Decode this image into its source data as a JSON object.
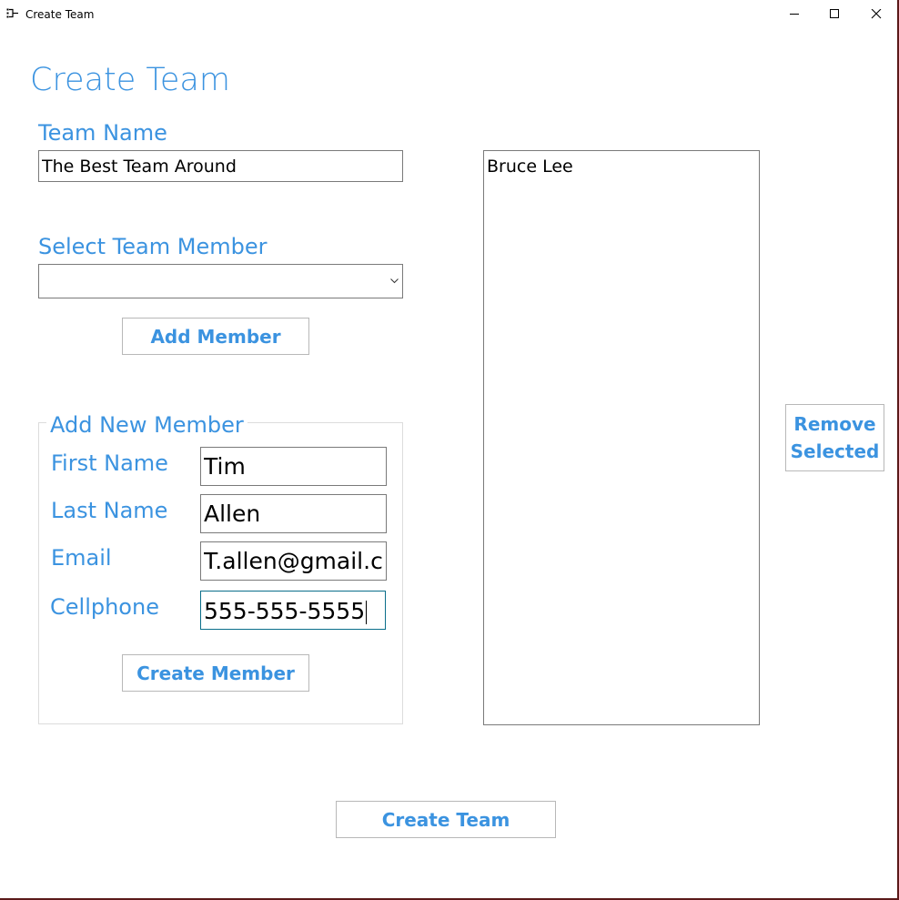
{
  "window": {
    "title": "Create Team",
    "controls": [
      "minimize-icon",
      "maximize-icon",
      "close-icon"
    ]
  },
  "header": {
    "title": "Create Team"
  },
  "team_name": {
    "label": "Team Name",
    "value": "The Best Team Around"
  },
  "select_member": {
    "label": "Select Team Member",
    "selected": ""
  },
  "buttons": {
    "add_member": "Add Member",
    "create_member": "Create Member",
    "remove_selected_line1": "Remove",
    "remove_selected_line2": "Selected",
    "create_team": "Create Team"
  },
  "new_member": {
    "group_title": "Add New Member",
    "first_name_label": "First Name",
    "first_name_value": "Tim",
    "last_name_label": "Last Name",
    "last_name_value": "Allen",
    "email_label": "Email",
    "email_value": "T.allen@gmail.com",
    "cellphone_label": "Cellphone",
    "cellphone_value": "555-555-5555"
  },
  "team_members": [
    "Bruce Lee"
  ],
  "colors": {
    "accent": "#3b93e0",
    "border": "#7a7a7a",
    "focus_border": "#0a6e8a"
  }
}
